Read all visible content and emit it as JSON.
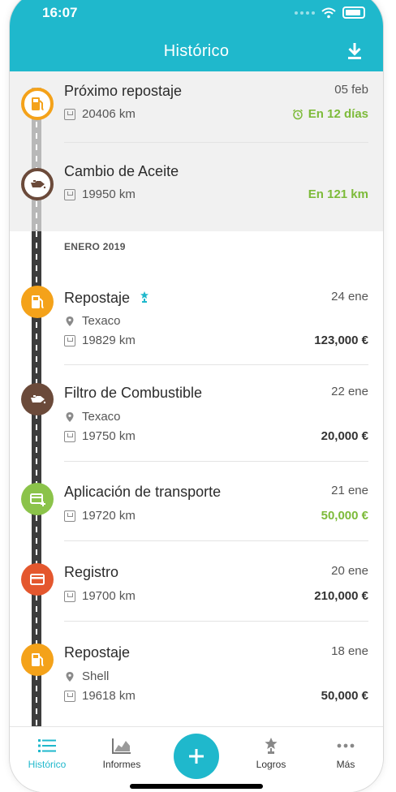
{
  "status_bar": {
    "time": "16:07"
  },
  "header": {
    "title": "Histórico"
  },
  "upcoming": [
    {
      "title": "Próximo repostaje",
      "date": "05 feb",
      "km": "20406 km",
      "due": "En 12 días",
      "icon": "fuel-icon",
      "color": "#f4a21a"
    },
    {
      "title": "Cambio de Aceite",
      "km": "19950 km",
      "due": "En 121 km",
      "icon": "oil-can-icon",
      "color": "#6b4a3a"
    }
  ],
  "section_label": "ENERO 2019",
  "entries": [
    {
      "title": "Repostaje",
      "date": "24 ene",
      "station": "Texaco",
      "km": "19829 km",
      "amount": "123,000 €",
      "icon": "fuel-icon",
      "color": "#f4a21a",
      "badge": "trophy-icon"
    },
    {
      "title": "Filtro de Combustible",
      "date": "22 ene",
      "station": "Texaco",
      "km": "19750 km",
      "amount": "20,000 €",
      "icon": "oil-can-icon",
      "color": "#6b4a3a"
    },
    {
      "title": "Aplicación de transporte",
      "date": "21 ene",
      "km": "19720 km",
      "amount": "50,000 €",
      "amount_color": "#7dbb3a",
      "icon": "card-plus-icon",
      "color": "#8bc34a"
    },
    {
      "title": "Registro",
      "date": "20 ene",
      "km": "19700 km",
      "amount": "210,000 €",
      "icon": "card-icon",
      "color": "#e4572e"
    },
    {
      "title": "Repostaje",
      "date": "18 ene",
      "station": "Shell",
      "km": "19618 km",
      "amount": "50,000 €",
      "icon": "fuel-icon",
      "color": "#f4a21a"
    }
  ],
  "tabbar": {
    "tabs": [
      {
        "label": "Histórico",
        "icon": "list-icon",
        "active": true
      },
      {
        "label": "Informes",
        "icon": "chart-icon"
      },
      {
        "label": "Logros",
        "icon": "trophy-icon"
      },
      {
        "label": "Más",
        "icon": "more-icon"
      }
    ],
    "add_icon": "plus-icon"
  },
  "colors": {
    "accent": "#1fb8cc",
    "positive": "#7dbb3a"
  }
}
